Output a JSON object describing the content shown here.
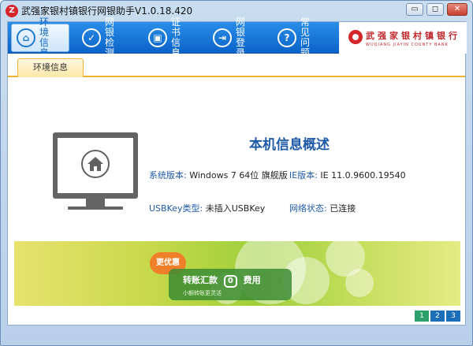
{
  "window": {
    "title": "武强家银村镇银行网银助手V1.0.18.420",
    "logo_char": "Z",
    "minimize": "▭",
    "restore": "◻",
    "close": "✕"
  },
  "nav": {
    "items": [
      {
        "label": "环境信息",
        "icon": "home-icon",
        "glyph": "⌂"
      },
      {
        "label": "网银检测",
        "icon": "check-icon",
        "glyph": "✓"
      },
      {
        "label": "证书信息",
        "icon": "certificate-icon",
        "glyph": "▣"
      },
      {
        "label": "网银登录",
        "icon": "login-icon",
        "glyph": "⇥"
      },
      {
        "label": "常见问题",
        "icon": "question-icon",
        "glyph": "?"
      }
    ]
  },
  "bank": {
    "name": "武强家银村镇银行",
    "subtitle": "WUQIANG JIAYIN COUNTY BANK"
  },
  "tab": {
    "label": "环境信息"
  },
  "info": {
    "title": "本机信息概述",
    "os_label": "系统版本:",
    "os_value": "Windows 7 64位 旗舰版",
    "ie_label": "IE版本:",
    "ie_value": "IE 11.0.9600.19540",
    "usbkey_label": "USBKey类型:",
    "usbkey_value": "未插入USBKey",
    "network_label": "网络状态:",
    "network_value": "已连接"
  },
  "banner": {
    "badge": "更优惠",
    "headline_left": "转账汇款",
    "headline_mark": "0",
    "headline_right": "费用",
    "subline": "小额转账更灵活"
  },
  "pager": {
    "pages": [
      "1",
      "2",
      "3"
    ],
    "active": 1
  },
  "colors": {
    "nav_blue": "#0b63c9",
    "accent_blue": "#1f5aa8",
    "bank_red": "#c1272d",
    "tab_orange": "#f0b030"
  }
}
